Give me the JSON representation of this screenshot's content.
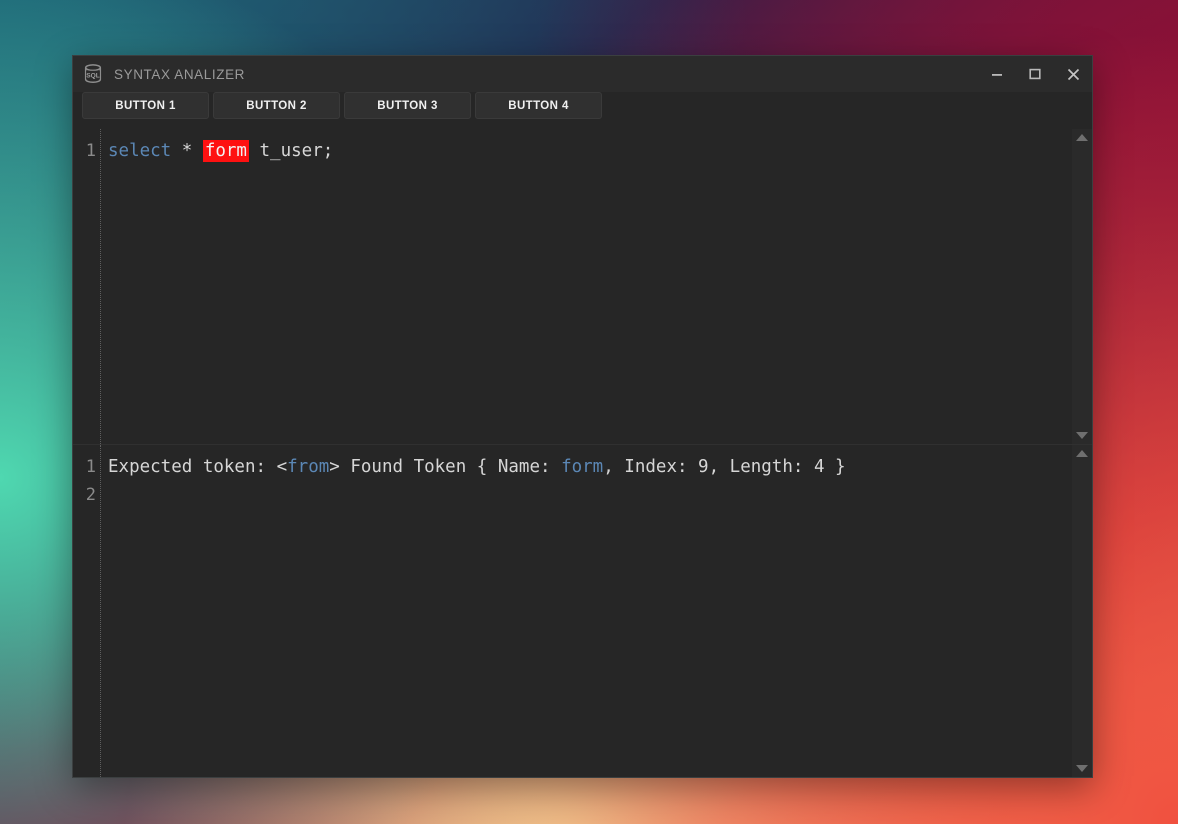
{
  "window": {
    "title": "SYNTAX ANALIZER",
    "icon": "sql-database-icon",
    "controls": {
      "minimize": "minimize-icon",
      "maximize": "maximize-icon",
      "close": "close-icon"
    }
  },
  "toolbar": {
    "buttons": [
      {
        "label": "BUTTON 1"
      },
      {
        "label": "BUTTON 2"
      },
      {
        "label": "BUTTON 3"
      },
      {
        "label": "BUTTON 4"
      }
    ]
  },
  "editor": {
    "line_numbers": [
      "1"
    ],
    "text": "select * form t_user;",
    "tokens": [
      {
        "text": "select",
        "style": "keyword"
      },
      {
        "text": " * ",
        "style": "plain"
      },
      {
        "text": "form",
        "style": "error"
      },
      {
        "text": " t_user;",
        "style": "plain"
      }
    ],
    "scroll": {
      "up": "scroll-up-arrow",
      "down": "scroll-down-arrow"
    }
  },
  "output": {
    "line_numbers": [
      "1",
      "2"
    ],
    "text": "Expected token: <from> Found Token { Name: form, Index: 9, Length: 4 }",
    "tokens": [
      {
        "text": "Expected token: <",
        "style": "plain"
      },
      {
        "text": "from",
        "style": "blue"
      },
      {
        "text": "> Found Token { Name: ",
        "style": "plain"
      },
      {
        "text": "form",
        "style": "blue"
      },
      {
        "text": ", Index: 9, Length: 4 }",
        "style": "plain"
      }
    ],
    "scroll": {
      "up": "scroll-up-arrow",
      "down": "scroll-down-arrow"
    }
  },
  "colors": {
    "window_bg": "#262626",
    "titlebar_bg": "#2b2b2b",
    "button_bg": "#303030",
    "keyword": "#5b87b5",
    "error_highlight": "#fe1111",
    "text": "#d6d6d6",
    "gutter_text": "#8b8b8b"
  }
}
